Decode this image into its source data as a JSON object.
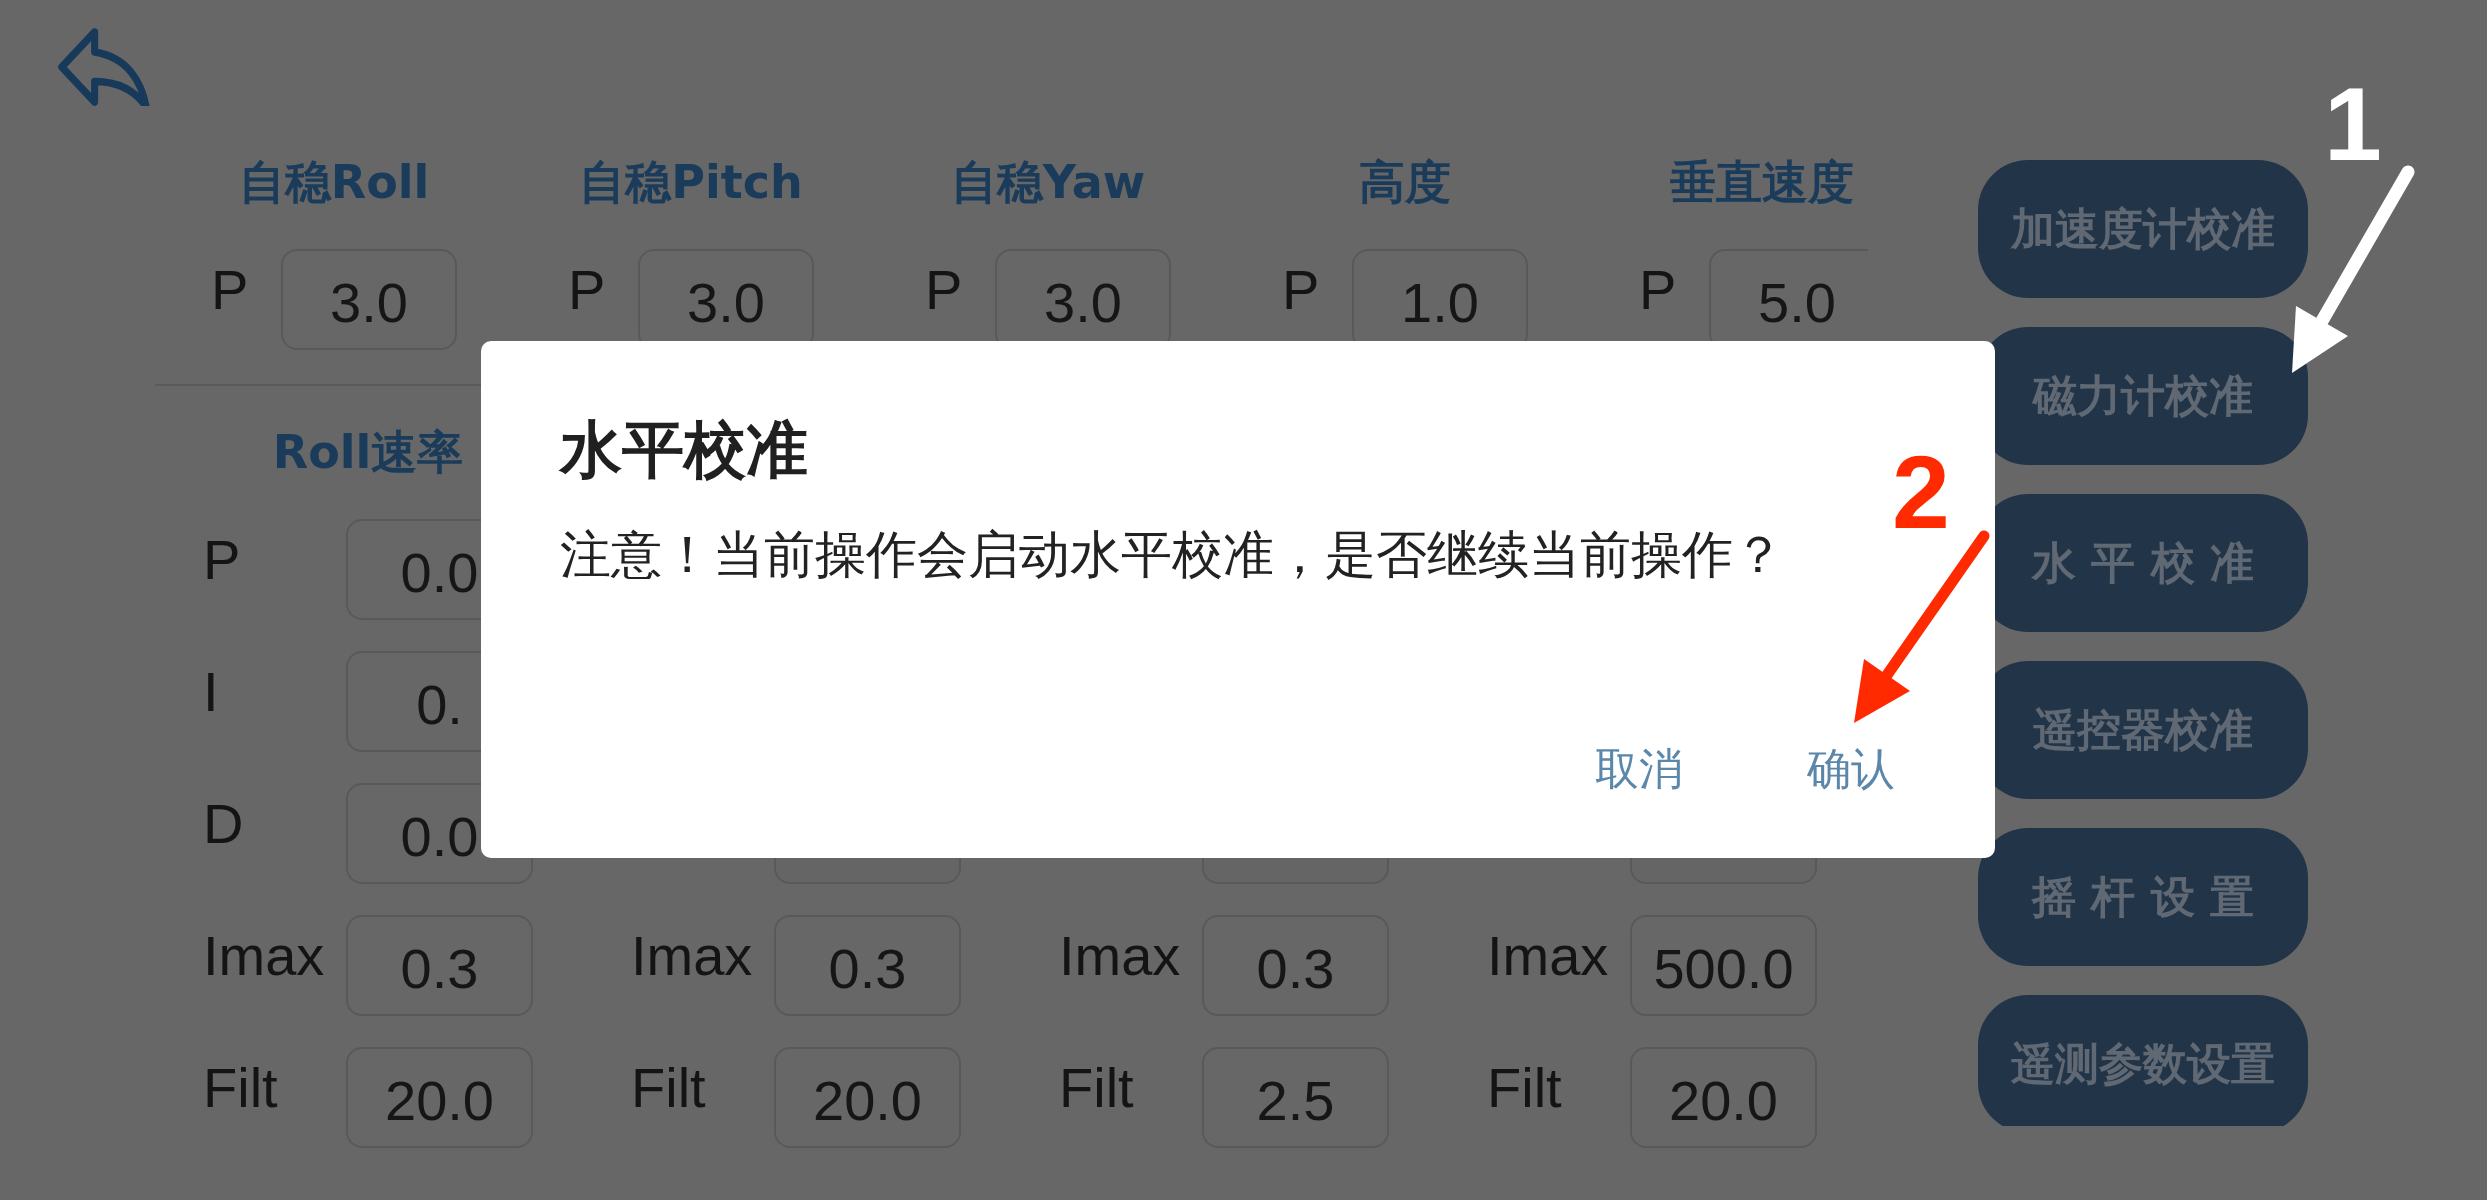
{
  "attitude_pid": {
    "columns": [
      {
        "header": "自稳Roll",
        "params": [
          {
            "label": "P",
            "value": "3.0"
          }
        ]
      },
      {
        "header": "自稳Pitch",
        "params": [
          {
            "label": "P",
            "value": "3.0"
          }
        ]
      },
      {
        "header": "自稳Yaw",
        "params": [
          {
            "label": "P",
            "value": "3.0"
          }
        ]
      },
      {
        "header": "高度",
        "params": [
          {
            "label": "P",
            "value": "1.0"
          }
        ]
      },
      {
        "header": "垂直速度",
        "params": [
          {
            "label": "P",
            "value": "5.0"
          }
        ]
      }
    ]
  },
  "rate_pid": {
    "header": "Roll速率",
    "rows": [
      [
        {
          "kind": "field",
          "label": "P",
          "value": "0.0"
        }
      ],
      [
        {
          "kind": "field",
          "label": "I",
          "value": "0."
        }
      ],
      [
        {
          "kind": "field",
          "label": "D",
          "value": "0.0"
        },
        {
          "kind": "covered"
        },
        {
          "kind": "covered"
        },
        {
          "kind": "covered"
        }
      ],
      [
        {
          "kind": "field",
          "label": "Imax",
          "value": "0.3"
        },
        {
          "kind": "field",
          "label": "Imax",
          "value": "0.3"
        },
        {
          "kind": "field",
          "label": "Imax",
          "value": "0.3"
        },
        {
          "kind": "field",
          "label": "Imax",
          "value": "500.0"
        }
      ],
      [
        {
          "kind": "field",
          "label": "Filt",
          "value": "20.0"
        },
        {
          "kind": "field",
          "label": "Filt",
          "value": "20.0"
        },
        {
          "kind": "field",
          "label": "Filt",
          "value": "2.5"
        },
        {
          "kind": "field",
          "label": "Filt",
          "value": "20.0"
        }
      ]
    ]
  },
  "calibration_buttons": [
    "加速度计校准",
    "磁力计校准",
    "水 平 校 准",
    "遥控器校准",
    "摇 杆 设 置",
    "遥测参数设置"
  ],
  "dialog": {
    "title": "水平校准",
    "message": "注意！当前操作会启动水平校准，是否继续当前操作？",
    "buttons": [
      "取消",
      "确认"
    ]
  },
  "annotations": [
    {
      "label": "1",
      "color": "#ffffff"
    },
    {
      "label": "2",
      "color": "#ff2a00"
    }
  ]
}
